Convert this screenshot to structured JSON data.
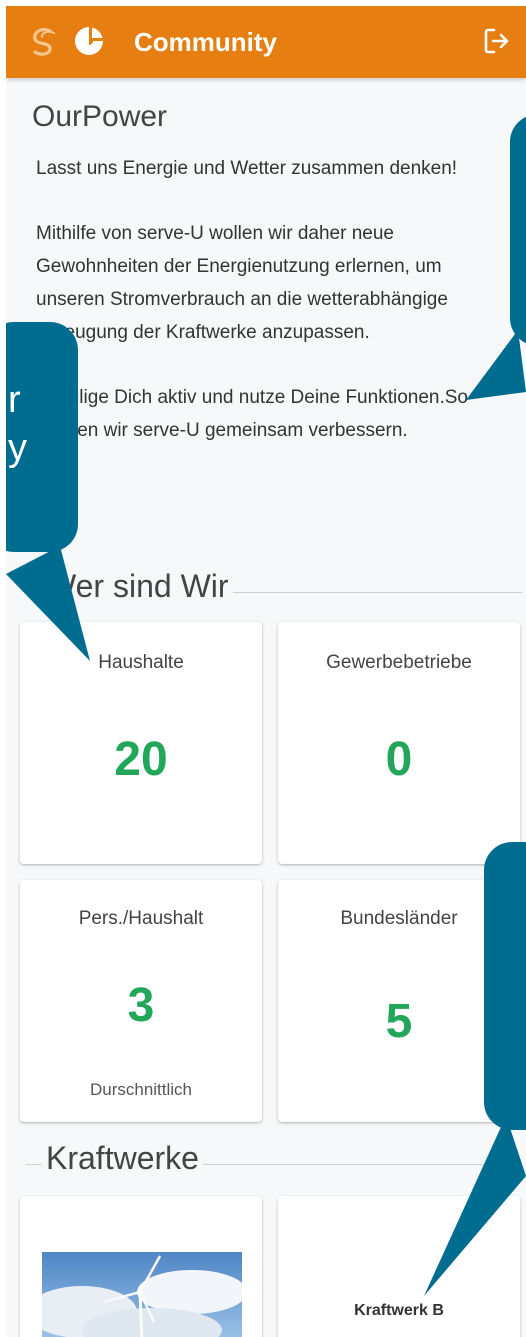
{
  "header": {
    "title": "Community",
    "icons": [
      "serve-u-logo-icon",
      "app-logo-icon",
      "logout-icon"
    ],
    "color": "#e67e12"
  },
  "community": {
    "name": "OurPower",
    "intro": [
      "Lasst uns Energie und Wetter zusammen denken!",
      "Mithilfe von serve-U wollen wir daher neue Gewohnheiten der Energienutzung erlernen, um unseren Stromverbrauch an die wetterabhängige Erzeugung der Kraftwerke anzupassen.",
      "Beteilige Dich aktiv und nutze Deine Funktionen.So können wir serve-U gemeinsam verbessern."
    ]
  },
  "stats_section": {
    "title": "Wer sind Wir",
    "cards": [
      {
        "label": "Haushalte",
        "value": "20",
        "sub": ""
      },
      {
        "label": "Gewerbebetriebe",
        "value": "0",
        "sub": ""
      },
      {
        "label": "Pers./Haushalt",
        "value": "3",
        "sub": "Durschnittlich"
      },
      {
        "label": "Bundesländer",
        "value": "5",
        "sub": ""
      }
    ],
    "value_color": "#21a65a"
  },
  "plants_section": {
    "title": "Kraftwerke",
    "plants": [
      {
        "name": "",
        "image": "wind-turbine-image"
      },
      {
        "name": "Kraftwerk B",
        "image": ""
      }
    ]
  },
  "overlay": {
    "bubble_color": "#006c8f",
    "left_bubble_fragments": [
      "r",
      "y"
    ]
  }
}
